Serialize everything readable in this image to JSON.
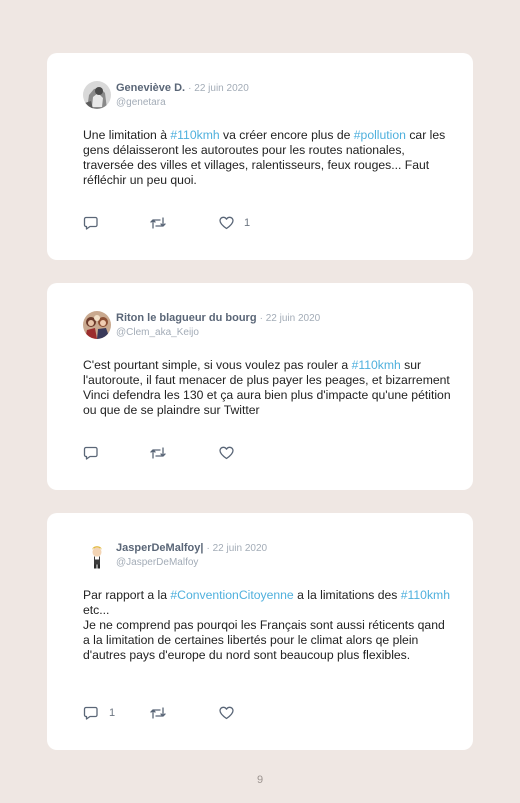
{
  "tweets": [
    {
      "author": "Geneviève D.",
      "date": "· 22 juin 2020",
      "handle": "@genetara",
      "segments": [
        {
          "t": "Une limitation à "
        },
        {
          "t": "#110kmh",
          "tag": true
        },
        {
          "t": " va créer encore plus de "
        },
        {
          "t": "#pollution",
          "tag": true
        },
        {
          "t": " car les gens délaisseront les autoroutes pour les routes nationales, traversée des villes et villages, ralentisseurs, feux rouges... Faut réfléchir un peu quoi."
        }
      ],
      "reply_count": "",
      "like_count": "1"
    },
    {
      "author": "Riton le blagueur du bourg",
      "date": "· 22 juin 2020",
      "handle": "@Clem_aka_Keijo",
      "segments": [
        {
          "t": "C'est pourtant simple, si vous voulez pas rouler a "
        },
        {
          "t": "#110kmh",
          "tag": true
        },
        {
          "t": " sur l'autoroute, il faut menacer de plus payer les peages, et bizarrement Vinci defendra les 130 et ça aura bien plus d'impacte qu'une pétition ou que de se plaindre sur Twitter"
        }
      ],
      "reply_count": "",
      "like_count": ""
    },
    {
      "author": "JasperDeMalfoy",
      "author_suffix": "|",
      "date": "· 22 juin 2020",
      "handle": "@JasperDeMalfoy",
      "segments": [
        {
          "t": "Par rapport a la "
        },
        {
          "t": "#ConventionCitoyenne",
          "tag": true
        },
        {
          "t": " a la limitations des "
        },
        {
          "t": "#110kmh",
          "tag": true
        },
        {
          "t": " etc..."
        },
        {
          "br": true
        },
        {
          "t": "Je ne comprend pas pourqoi les Français sont aussi réticents qand a la limitation de certaines libertés pour le climat alors qe plein d'autres pays d'europe du nord sont beaucoup plus flexibles."
        }
      ],
      "reply_count": "1",
      "like_count": ""
    }
  ],
  "page_number": "9",
  "colors": {
    "background": "#efe7e3",
    "card": "#ffffff",
    "hashtag": "#4fb0dd",
    "name": "#5a6677",
    "muted": "#a3acb7",
    "icon": "#5a6677"
  },
  "icons": [
    "reply-icon",
    "retweet-icon",
    "like-icon"
  ]
}
